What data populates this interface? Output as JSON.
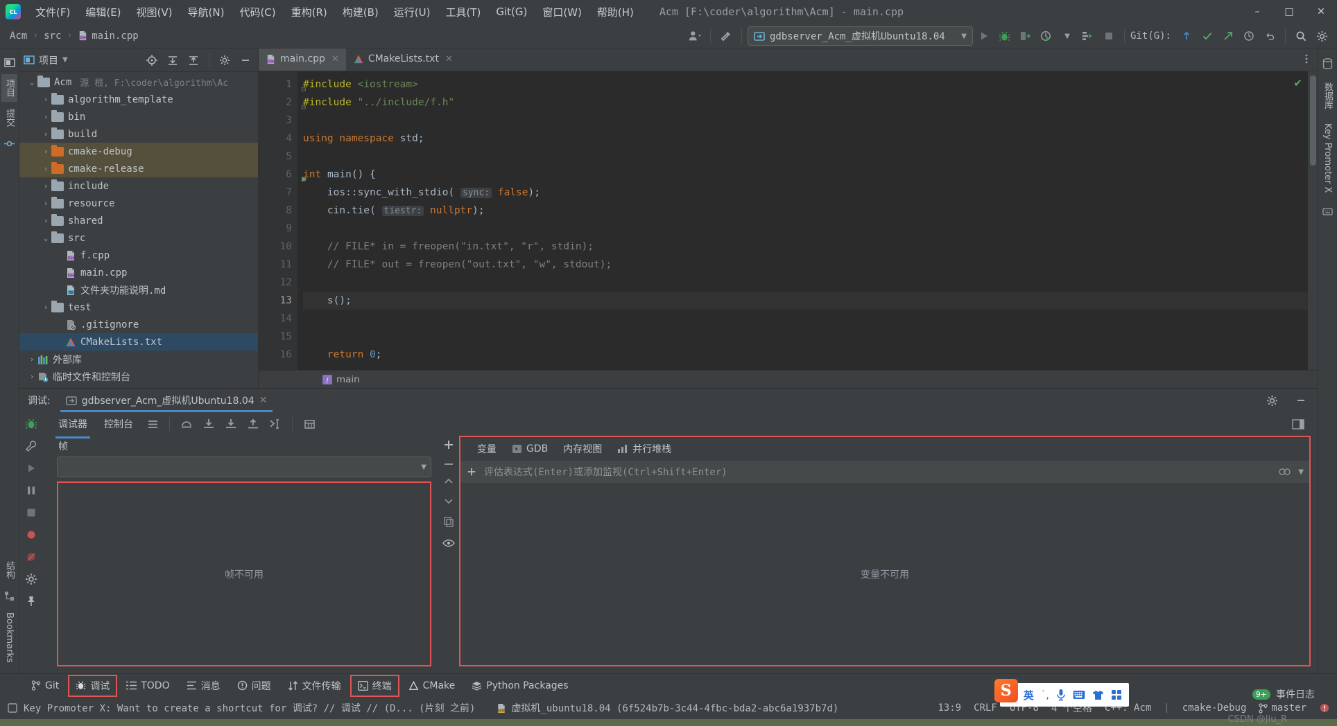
{
  "window": {
    "title": "Acm [F:\\coder\\algorithm\\Acm] - main.cpp",
    "minimize": "–",
    "maximize": "□",
    "close": "✕",
    "logo_text": "CL"
  },
  "menubar": {
    "items": [
      {
        "label": "文件(F)",
        "name": "menu-file"
      },
      {
        "label": "编辑(E)",
        "name": "menu-edit"
      },
      {
        "label": "视图(V)",
        "name": "menu-view"
      },
      {
        "label": "导航(N)",
        "name": "menu-navigate"
      },
      {
        "label": "代码(C)",
        "name": "menu-code"
      },
      {
        "label": "重构(R)",
        "name": "menu-refactor"
      },
      {
        "label": "构建(B)",
        "name": "menu-build"
      },
      {
        "label": "运行(U)",
        "name": "menu-run"
      },
      {
        "label": "工具(T)",
        "name": "menu-tools"
      },
      {
        "label": "Git(G)",
        "name": "menu-git"
      },
      {
        "label": "窗口(W)",
        "name": "menu-window"
      },
      {
        "label": "帮助(H)",
        "name": "menu-help"
      }
    ]
  },
  "navbar": {
    "breadcrumb": [
      "Acm",
      "src",
      "main.cpp"
    ],
    "run_config": "gdbserver_Acm_虚拟机Ubuntu18.04",
    "git_label": "Git(G):"
  },
  "left_strip": {
    "items": [
      "项目",
      "提交",
      "结构",
      "Bookmarks"
    ]
  },
  "right_strip": {
    "items": [
      "数据库",
      "Key Promoter X"
    ]
  },
  "project_panel": {
    "title": "项目",
    "tree": [
      {
        "label": "Acm",
        "sub": "源 根, F:\\coder\\algorithm\\Ac",
        "depth": 0,
        "icon": "folder-root",
        "arrow": "open",
        "state": "none"
      },
      {
        "label": "algorithm_template",
        "sub": "",
        "depth": 1,
        "icon": "folder",
        "arrow": "closed",
        "state": "none"
      },
      {
        "label": "bin",
        "sub": "",
        "depth": 1,
        "icon": "folder",
        "arrow": "closed",
        "state": "none"
      },
      {
        "label": "build",
        "sub": "",
        "depth": 1,
        "icon": "folder",
        "arrow": "closed",
        "state": "none"
      },
      {
        "label": "cmake-debug",
        "sub": "",
        "depth": 1,
        "icon": "folder-orange",
        "arrow": "closed",
        "state": "highlight"
      },
      {
        "label": "cmake-release",
        "sub": "",
        "depth": 1,
        "icon": "folder-orange",
        "arrow": "closed",
        "state": "highlight"
      },
      {
        "label": "include",
        "sub": "",
        "depth": 1,
        "icon": "folder",
        "arrow": "closed",
        "state": "none"
      },
      {
        "label": "resource",
        "sub": "",
        "depth": 1,
        "icon": "folder",
        "arrow": "closed",
        "state": "none"
      },
      {
        "label": "shared",
        "sub": "",
        "depth": 1,
        "icon": "folder",
        "arrow": "closed",
        "state": "none"
      },
      {
        "label": "src",
        "sub": "",
        "depth": 1,
        "icon": "folder",
        "arrow": "open",
        "state": "none"
      },
      {
        "label": "f.cpp",
        "sub": "",
        "depth": 2,
        "icon": "cpp",
        "arrow": "none",
        "state": "none"
      },
      {
        "label": "main.cpp",
        "sub": "",
        "depth": 2,
        "icon": "cpp",
        "arrow": "none",
        "state": "none"
      },
      {
        "label": "文件夹功能说明.md",
        "sub": "",
        "depth": 2,
        "icon": "md",
        "arrow": "none",
        "state": "none"
      },
      {
        "label": "test",
        "sub": "",
        "depth": 1,
        "icon": "folder",
        "arrow": "closed",
        "state": "none"
      },
      {
        "label": ".gitignore",
        "sub": "",
        "depth": 2,
        "icon": "gitignore",
        "arrow": "none",
        "state": "none"
      },
      {
        "label": "CMakeLists.txt",
        "sub": "",
        "depth": 2,
        "icon": "cmake",
        "arrow": "none",
        "state": "selected"
      },
      {
        "label": "外部库",
        "sub": "",
        "depth": 0,
        "icon": "library",
        "arrow": "closed",
        "state": "none"
      },
      {
        "label": "临时文件和控制台",
        "sub": "",
        "depth": 0,
        "icon": "scratch",
        "arrow": "closed",
        "state": "none"
      }
    ]
  },
  "editor": {
    "tabs": [
      {
        "label": "main.cpp",
        "icon": "cpp",
        "active": true
      },
      {
        "label": "CMakeLists.txt",
        "icon": "cmake",
        "active": false
      }
    ],
    "lines": [
      {
        "n": "1",
        "html": "<span class=\"pp\">#include</span> <span class=\"s\">&lt;iostream&gt;</span>",
        "fold": true
      },
      {
        "n": "2",
        "html": "<span class=\"pp\">#include</span> <span class=\"s\">\"../include/f.h\"</span>",
        "fold": true
      },
      {
        "n": "3",
        "html": ""
      },
      {
        "n": "4",
        "html": "<span class=\"k\">using namespace</span> <span class=\"d\">std</span><span class=\"d\">;</span>"
      },
      {
        "n": "5",
        "html": ""
      },
      {
        "n": "6",
        "html": "<span class=\"k\">int</span> <span class=\"d\">main</span><span class=\"d\">() {</span>",
        "run": true,
        "fold": true
      },
      {
        "n": "7",
        "html": "    <span class=\"d\">ios::sync_with_stdio(</span> <span class=\"hintbox\">sync:</span> <span class=\"k\">false</span><span class=\"d\">);</span>"
      },
      {
        "n": "8",
        "html": "    <span class=\"d\">cin.tie(</span> <span class=\"hintbox\">tiestr:</span> <span class=\"k\">nullptr</span><span class=\"d\">);</span>"
      },
      {
        "n": "9",
        "html": ""
      },
      {
        "n": "10",
        "html": "    <span class=\"cm\">// FILE* in = freopen(\"in.txt\", \"r\", stdin);</span>"
      },
      {
        "n": "11",
        "html": "    <span class=\"cm\">// FILE* out = freopen(\"out.txt\", \"w\", stdout);</span>"
      },
      {
        "n": "12",
        "html": ""
      },
      {
        "n": "13",
        "html": "    <span class=\"d\">s();</span>",
        "cur": true
      },
      {
        "n": "14",
        "html": ""
      },
      {
        "n": "15",
        "html": ""
      },
      {
        "n": "16",
        "html": "    <span class=\"k\">return</span> <span class=\"n\">0</span><span class=\"d\">;</span>"
      }
    ],
    "footer_crumb": "main"
  },
  "debug": {
    "header_label": "调试:",
    "tab_title": "gdbserver_Acm_虚拟机Ubuntu18.04",
    "subtabs": [
      "调试器",
      "控制台"
    ],
    "frames_header": "帧",
    "frames_empty": "帧不可用",
    "var_tabs": [
      "变量",
      "GDB",
      "内存视图",
      "并行堆栈"
    ],
    "eval_placeholder": "评估表达式(Enter)或添加监视(Ctrl+Shift+Enter)",
    "vars_empty": "变量不可用"
  },
  "bottom_bar": {
    "items": [
      {
        "label": "Git",
        "icon": "git-branch-icon",
        "boxed": false
      },
      {
        "label": "调试",
        "icon": "bug-icon",
        "boxed": true
      },
      {
        "label": "TODO",
        "icon": "list-icon",
        "boxed": false
      },
      {
        "label": "消息",
        "icon": "message-icon",
        "boxed": false
      },
      {
        "label": "问题",
        "icon": "problem-icon",
        "boxed": false
      },
      {
        "label": "文件传输",
        "icon": "transfer-icon",
        "boxed": false
      },
      {
        "label": "终端",
        "icon": "terminal-icon",
        "boxed": true
      },
      {
        "label": "CMake",
        "icon": "cmake-icon",
        "boxed": false
      },
      {
        "label": "Python Packages",
        "icon": "python-icon",
        "boxed": false
      }
    ]
  },
  "status_bar": {
    "notification": "Key Promoter X: Want to create a shortcut for 调试? // 调试 // (D... (片刻 之前)",
    "deployment": "虚拟机_ubuntu18.04 (6f524b7b-3c44-4fbc-bda2-abc6a1937b7d)",
    "caret": "13:9",
    "line_sep": "CRLF",
    "encoding": "UTF-8",
    "indent": "4 个空格",
    "language": "C++: Acm",
    "profile": "cmake-Debug",
    "branch": "master",
    "event_log": "事件日志",
    "event_count": "9+",
    "watermark": "CSDN @Jiu_R"
  },
  "ime": {
    "mode": "英",
    "items": [
      "·,",
      "mic-icon",
      "keyboard-icon",
      "skin-icon",
      "apps-icon"
    ]
  },
  "colors": {
    "accent": "#4a88c7",
    "highlight_box": "#e05555",
    "selection": "#2e4a62",
    "cmake_highlight": "#54503c",
    "green": "#59a869"
  }
}
